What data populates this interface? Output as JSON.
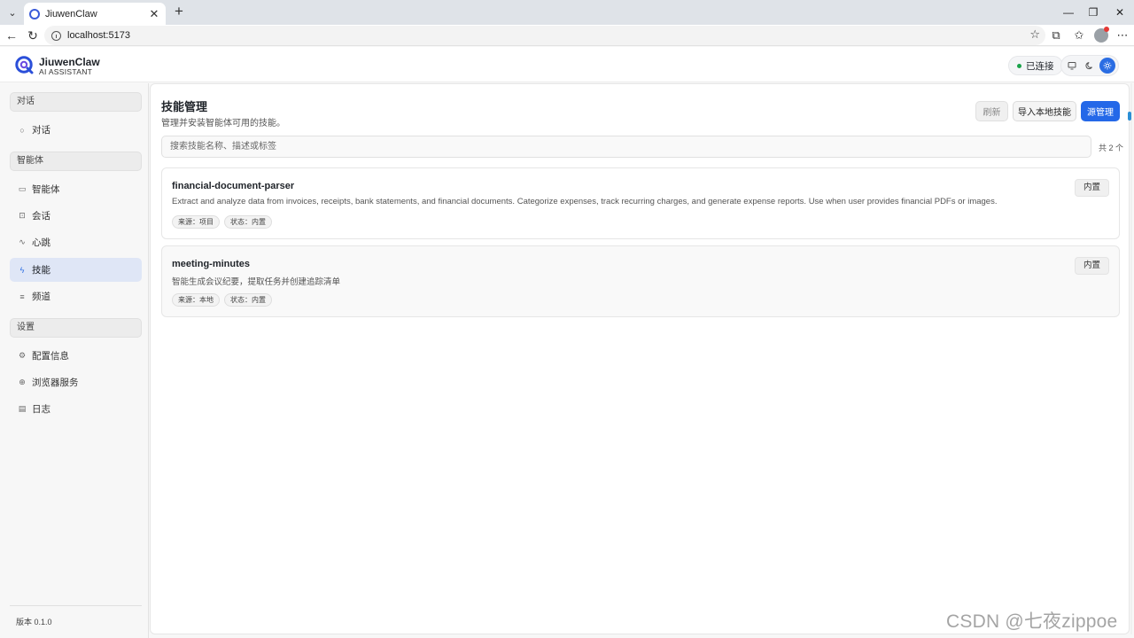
{
  "browser": {
    "tab_title": "JiuwenClaw",
    "url": "localhost:5173"
  },
  "header": {
    "brand_name": "JiuwenClaw",
    "brand_sub": "AI ASSISTANT",
    "connection_status": "已连接",
    "connection_color": "#1aa34a",
    "accent": "#2b6de3"
  },
  "sidebar": {
    "groups": {
      "chat": "对话",
      "agent": "智能体",
      "settings": "设置"
    },
    "items": [
      {
        "label": "对话",
        "icon": "chat-bubble-icon"
      },
      {
        "label": "智能体",
        "icon": "monitor-icon"
      },
      {
        "label": "会话",
        "icon": "session-icon"
      },
      {
        "label": "心跳",
        "icon": "heartbeat-icon"
      },
      {
        "label": "技能",
        "icon": "lightning-icon",
        "active": true
      },
      {
        "label": "频道",
        "icon": "list-icon"
      },
      {
        "label": "配置信息",
        "icon": "gear-icon"
      },
      {
        "label": "浏览器服务",
        "icon": "globe-icon"
      },
      {
        "label": "日志",
        "icon": "document-icon"
      }
    ],
    "version": "版本 0.1.0"
  },
  "main": {
    "title": "技能管理",
    "subtitle": "管理并安装智能体可用的技能。",
    "refresh_label": "刷新",
    "import_label": "导入本地技能",
    "source_label": "源管理",
    "search_placeholder": "搜索技能名称、描述或标签",
    "count_text": "共 2 个",
    "skills": [
      {
        "name": "financial-document-parser",
        "description": "Extract and analyze data from invoices, receipts, bank statements, and financial documents. Categorize expenses, track recurring charges, and generate expense reports. Use when user provides financial PDFs or images.",
        "source": "来源：项目",
        "status": "状态：内置",
        "badge": "内置"
      },
      {
        "name": "meeting-minutes",
        "description": "智能生成会议纪要，提取任务并创建追踪清单",
        "source": "来源：本地",
        "status": "状态：内置",
        "badge": "内置"
      }
    ]
  },
  "watermark": "CSDN @七夜zippoe"
}
